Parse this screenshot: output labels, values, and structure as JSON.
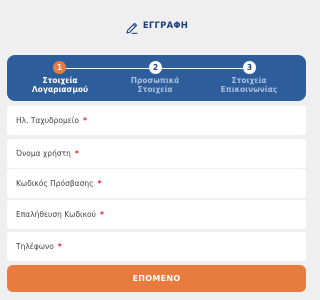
{
  "header": {
    "icon": "pen-icon",
    "title": "ΕΓΓΡΑΦΗ"
  },
  "stepper": {
    "steps": [
      {
        "number": "1",
        "label_line1": "Στοιχεία",
        "label_line2": "Λογαριασμού",
        "active": true
      },
      {
        "number": "2",
        "label_line1": "Προσωπικά",
        "label_line2": "Στοιχεία",
        "active": false
      },
      {
        "number": "3",
        "label_line1": "Στοιχεία",
        "label_line2": "Επικοινωνίας",
        "active": false
      }
    ]
  },
  "form": {
    "required_marker": "*",
    "fields": [
      {
        "placeholder": "Ηλ. Ταχυδρομείο"
      },
      {
        "placeholder": "Όνομα χρήστη"
      },
      {
        "placeholder": "Κωδικός Πρόσβασης"
      },
      {
        "placeholder": "Επαλήθευση Κωδικού"
      },
      {
        "placeholder": "Τηλέφωνο"
      }
    ]
  },
  "next_button": {
    "label": "ΕΠΟΜΕΝΟ"
  },
  "colors": {
    "primary_blue": "#2e5d9b",
    "accent_orange": "#e87b3e",
    "required_red": "#e0242a",
    "background": "#efefef"
  }
}
